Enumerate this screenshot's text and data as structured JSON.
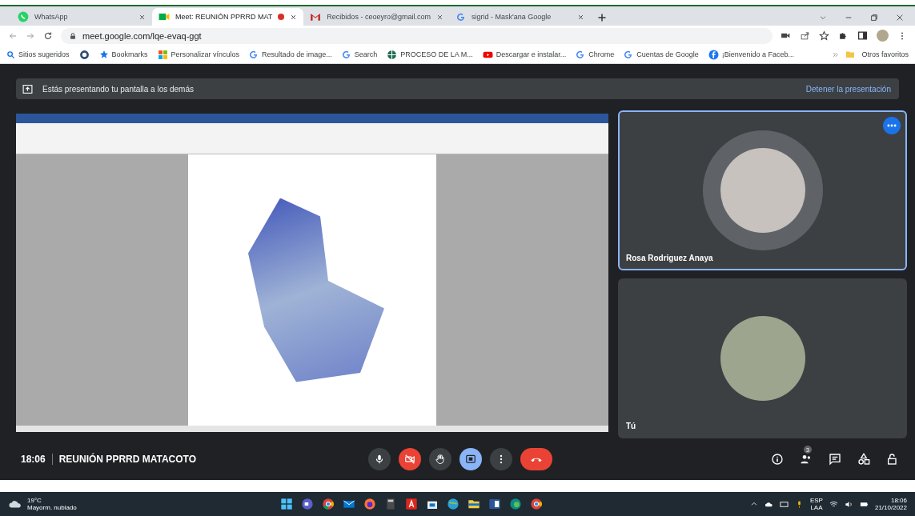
{
  "browser": {
    "tabs": [
      {
        "title": "WhatsApp",
        "selected": false,
        "recording": false
      },
      {
        "title": "Meet: REUNIÓN PPRRD MAT",
        "selected": true,
        "recording": true
      },
      {
        "title": "Recibidos - ceoeyro@gmail.com",
        "selected": false,
        "recording": false
      },
      {
        "title": "sigrid - Mask'ana Google",
        "selected": false,
        "recording": false
      }
    ],
    "url": "meet.google.com/lqe-evaq-ggt",
    "bookmarks": [
      {
        "label": "Sitios sugeridos"
      },
      {
        "label": "Bookmarks"
      },
      {
        "label": "Personalizar vínculos"
      },
      {
        "label": "Resultado de image..."
      },
      {
        "label": "Search"
      },
      {
        "label": "PROCESO DE LA M..."
      },
      {
        "label": "Descargar e instalar..."
      },
      {
        "label": "Chrome"
      },
      {
        "label": "Cuentas de Google"
      },
      {
        "label": "¡Bienvenido a Faceb..."
      }
    ],
    "other_bookmarks": "Otros favoritos"
  },
  "meet": {
    "banner": {
      "text": "Estás presentando tu pantalla a los demás",
      "action": "Detener la presentación"
    },
    "participants": [
      {
        "name": "Rosa Rodriguez Anaya",
        "highlighted": true
      },
      {
        "name": "Tú",
        "highlighted": false
      }
    ],
    "time": "18:06",
    "meeting_title": "REUNIÓN PPRRD MATACOTO",
    "controls": [
      {
        "kind": "mic",
        "on": true
      },
      {
        "kind": "camera",
        "on": false
      },
      {
        "kind": "hand",
        "on": false
      },
      {
        "kind": "present",
        "on": true
      },
      {
        "kind": "more",
        "on": false
      },
      {
        "kind": "leave",
        "on": true
      }
    ],
    "people_count": "3"
  },
  "taskbar": {
    "temperature": "19°C",
    "weather": "Mayorm. nublado",
    "language": "ESP",
    "layout": "LAA",
    "time": "18:06",
    "date": "21/10/2022"
  }
}
